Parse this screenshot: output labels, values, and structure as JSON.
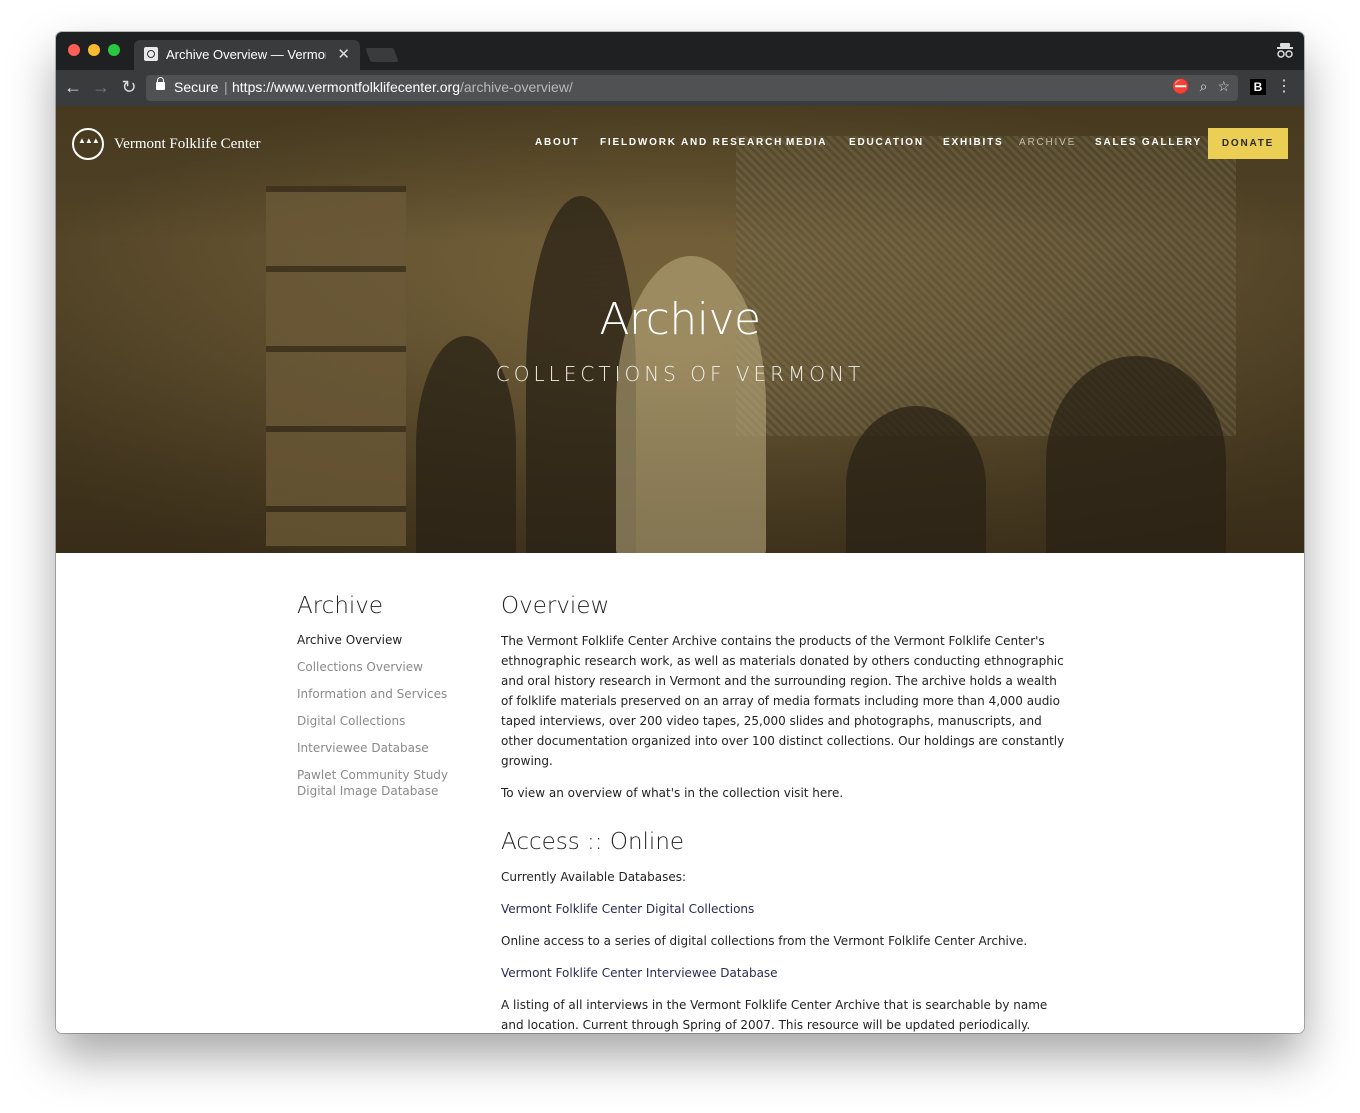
{
  "browser": {
    "tab_title": "Archive Overview — Vermont Folklife Center",
    "tab_close": "✕",
    "secure_label": "Secure",
    "url_host": "https://www.vermontfolklifecenter.org",
    "url_path": "/archive-overview/",
    "ext_b": "B"
  },
  "site": {
    "logo_text": "Vermont Folklife Center",
    "nav": [
      {
        "label": "ABOUT"
      },
      {
        "label": "FIELDWORK AND RESEARCH"
      },
      {
        "label": "MEDIA"
      },
      {
        "label": "EDUCATION"
      },
      {
        "label": "EXHIBITS"
      },
      {
        "label": "ARCHIVE"
      },
      {
        "label": "SALES GALLERY"
      }
    ],
    "donate": "DONATE"
  },
  "hero": {
    "title": "Archive",
    "subtitle": "COLLECTIONS OF VERMONT"
  },
  "sidebar": {
    "title": "Archive",
    "items": [
      {
        "label": "Archive Overview"
      },
      {
        "label": "Collections Overview"
      },
      {
        "label": "Information and Services"
      },
      {
        "label": "Digital Collections"
      },
      {
        "label": "Interviewee Database"
      },
      {
        "label": "Pawlet Community Study Digital Image Database"
      }
    ]
  },
  "main": {
    "overview_heading": "Overview",
    "overview_text": "The Vermont Folklife Center Archive contains the products of the Vermont Folklife Center's ethnographic research work, as well as materials donated by others conducting ethnographic and oral history research in Vermont and the surrounding region. The archive holds a wealth of folklife materials preserved on an array of media formats including more than 4,000 audio taped interviews, over 200 video tapes, 25,000 slides and photographs, manuscripts, and other documentation organized into over 100 distinct collections. Our holdings are constantly growing.",
    "visit_text": "To view an overview of what's in the collection visit here.",
    "access_heading": "Access :: Online",
    "databases_label": "Currently Available Databases:",
    "db1_link": "Vermont Folklife Center Digital Collections",
    "db1_desc": "Online access to a series of digital collections from the Vermont Folklife Center Archive.",
    "db2_link": "Vermont Folklife Center Interviewee Database",
    "db2_desc": "A listing of all interviews in the Vermont Folklife Center Archive that is searchable by name and location. Current through Spring of 2007. This resource will be updated periodically."
  },
  "colors": {
    "donate_bg": "#ebcf55",
    "tab_bg": "#1f2022"
  }
}
